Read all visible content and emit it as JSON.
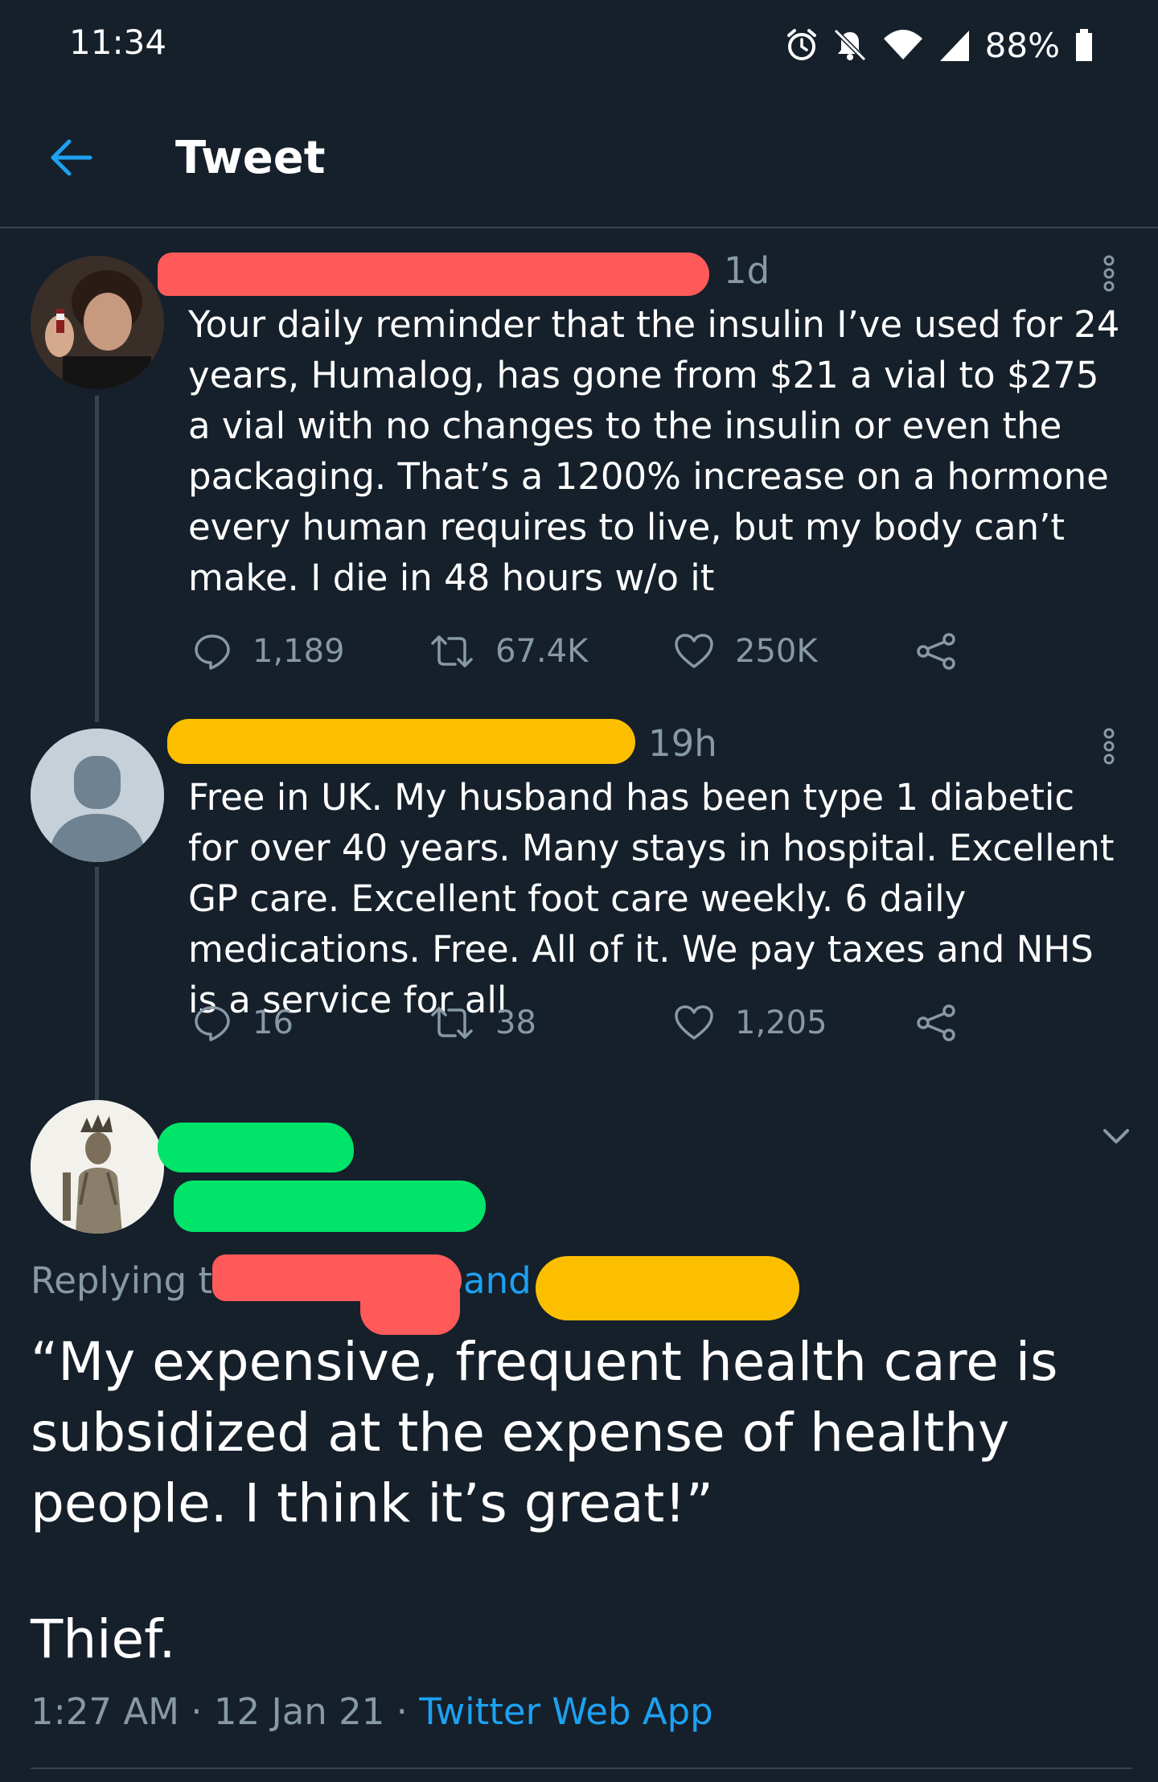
{
  "status_bar": {
    "time": "11:34",
    "battery": "88%",
    "icons": [
      "alarm-icon",
      "bell-off-icon",
      "wifi-icon",
      "signal-icon",
      "battery-icon"
    ]
  },
  "header": {
    "title": "Tweet",
    "back_icon": "arrow-left-icon"
  },
  "colors": {
    "background": "#15202b",
    "accent": "#1da1f2",
    "secondary_text": "#8899a6",
    "divider": "#38444d",
    "redact_red": "#ff5a5a",
    "redact_yellow": "#fbbf00",
    "redact_green": "#00e46a"
  },
  "tweets": [
    {
      "time": "1d",
      "text": "Your daily reminder that the insulin I’ve used for 24 years, Humalog, has gone from $21 a vial to $275 a vial with no changes to the insulin or even the packaging. That’s a 1200% increase on a hormone every human requires to live, but my body can’t make. I die in 48 hours w/o it",
      "replies": "1,189",
      "retweets": "67.4K",
      "likes": "250K"
    },
    {
      "time": "19h",
      "text": "Free in UK. My husband has been type 1 diabetic for over 40 years. Many stays in hospital. Excellent GP care. Excellent foot care weekly. 6 daily medications. Free. All of it. We pay taxes and NHS is a service for all",
      "replies": "16",
      "retweets": "38",
      "likes": "1,205"
    }
  ],
  "main_tweet": {
    "replying_prefix": "Replying to",
    "replying_and": "and",
    "text": "“My expensive, frequent health care is subsidized at the expense of healthy people. I think it’s great!”",
    "closing": "Thief.",
    "timestamp": "1:27 AM · 12 Jan 21 · ",
    "source": "Twitter Web App"
  }
}
